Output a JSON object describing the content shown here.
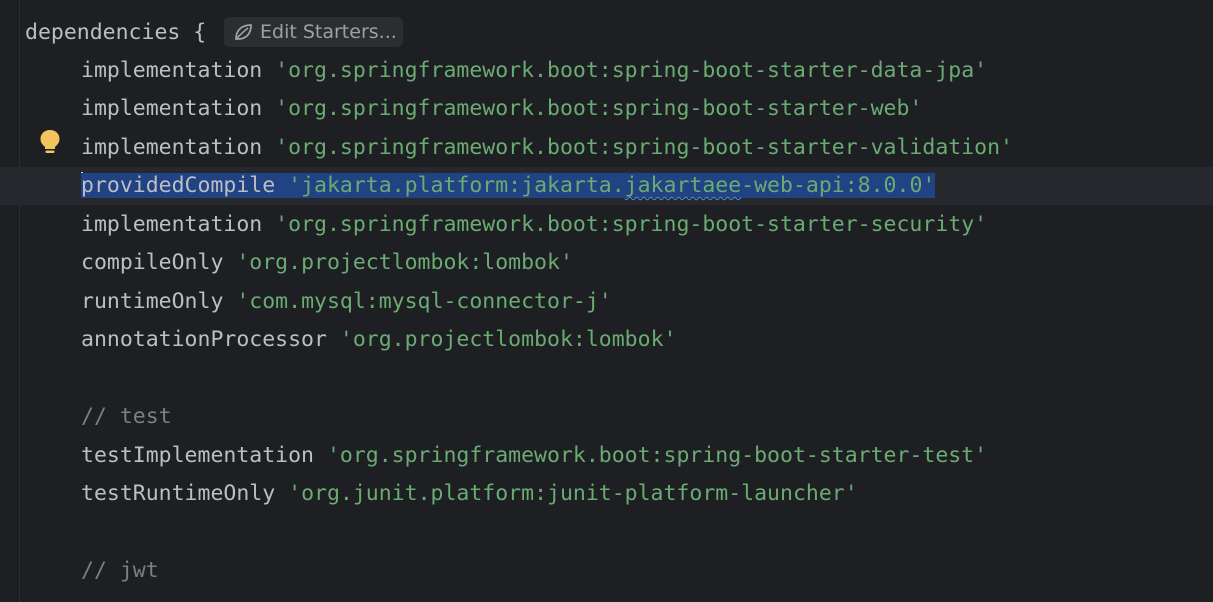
{
  "editor": {
    "header": {
      "keyword": "dependencies",
      "brace": "{",
      "starters_button_label": "Edit Starters..."
    },
    "lines": [
      {
        "kw": "implementation",
        "str": "'org.springframework.boot:spring-boot-starter-data-jpa'"
      },
      {
        "kw": "implementation",
        "str": "'org.springframework.boot:spring-boot-starter-web'"
      },
      {
        "kw": "implementation",
        "str": "'org.springframework.boot:spring-boot-starter-validation'"
      },
      {
        "kw": "providedCompile",
        "str_part1": "'jakarta.platform:jakarta.",
        "str_squiggle": "jakartaee",
        "str_part2": "-web-api:8.0.0'"
      },
      {
        "kw": "implementation",
        "str": "'org.springframework.boot:spring-boot-starter-security'"
      },
      {
        "kw": "compileOnly",
        "str": "'org.projectlombok:lombok'"
      },
      {
        "kw": "runtimeOnly",
        "str": "'com.mysql:mysql-connector-j'"
      },
      {
        "kw": "annotationProcessor",
        "str": "'org.projectlombok:lombok'"
      },
      {
        "comment": "// test"
      },
      {
        "kw": "testImplementation",
        "str": "'org.springframework.boot:spring-boot-starter-test'"
      },
      {
        "kw": "testRuntimeOnly",
        "str": "'org.junit.platform:junit-platform-launcher'"
      },
      {
        "comment": "// jwt"
      }
    ],
    "icons": {
      "starters": "spring-leaf-icon",
      "intention": "lightbulb-icon"
    },
    "colors": {
      "background": "#1e1f22",
      "keyword": "#bcbec4",
      "string": "#6aab73",
      "comment": "#7a7e85",
      "selection": "#214283",
      "bulb": "#f2c55c"
    }
  }
}
